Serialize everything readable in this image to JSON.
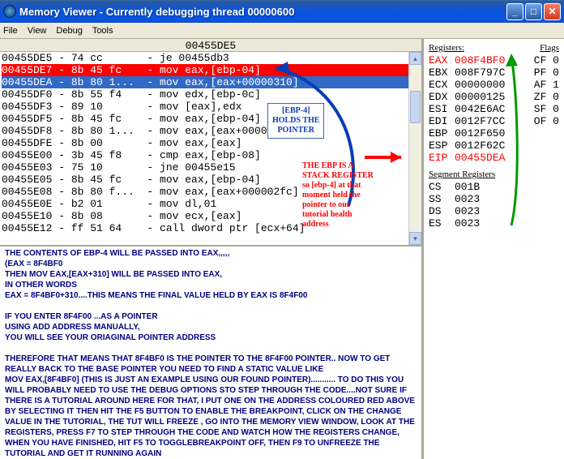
{
  "window": {
    "title": "Memory Viewer - Currently debugging thread 00000600"
  },
  "menu": {
    "file": "File",
    "view": "View",
    "debug": "Debug",
    "tools": "Tools"
  },
  "disasm": {
    "header": "00455DE5",
    "rows": [
      {
        "cls": "",
        "addr": "00455DE5",
        "bytes": "74 cc",
        "op": "je 00455db3"
      },
      {
        "cls": "red",
        "addr": "00455DE7",
        "bytes": "8b 45 fc",
        "op": "mov eax,[ebp-04]"
      },
      {
        "cls": "blue",
        "addr": "00455DEA",
        "bytes": "8b 80 1...",
        "op": "mov eax,[eax+00000310]"
      },
      {
        "cls": "",
        "addr": "00455DF0",
        "bytes": "8b 55 f4",
        "op": "mov edx,[ebp-0c]"
      },
      {
        "cls": "",
        "addr": "00455DF3",
        "bytes": "89 10",
        "op": "mov [eax],edx"
      },
      {
        "cls": "",
        "addr": "00455DF5",
        "bytes": "8b 45 fc",
        "op": "mov eax,[ebp-04]"
      },
      {
        "cls": "",
        "addr": "00455DF8",
        "bytes": "8b 80 1...",
        "op": "mov eax,[eax+00000310]"
      },
      {
        "cls": "",
        "addr": "00455DFE",
        "bytes": "8b 00",
        "op": "mov eax,[eax]"
      },
      {
        "cls": "",
        "addr": "00455E00",
        "bytes": "3b 45 f8",
        "op": "cmp eax,[ebp-08]"
      },
      {
        "cls": "",
        "addr": "00455E03",
        "bytes": "75 10",
        "op": "jne 00455e15"
      },
      {
        "cls": "",
        "addr": "00455E05",
        "bytes": "8b 45 fc",
        "op": "mov eax,[ebp-04]"
      },
      {
        "cls": "",
        "addr": "00455E08",
        "bytes": "8b 80 f...",
        "op": "mov eax,[eax+000002fc]"
      },
      {
        "cls": "",
        "addr": "00455E0E",
        "bytes": "b2 01",
        "op": "mov dl,01"
      },
      {
        "cls": "",
        "addr": "00455E10",
        "bytes": "8b 08",
        "op": "mov ecx,[eax]"
      },
      {
        "cls": "",
        "addr": "00455E12",
        "bytes": "ff 51 64",
        "op": "call dword ptr [ecx+64]"
      }
    ]
  },
  "registers": {
    "hdrReg": "Registers:",
    "hdrFlag": "Flags",
    "rows": [
      {
        "n": "EAX",
        "v": "008F4BF0",
        "f": "CF 0",
        "red": true
      },
      {
        "n": "EBX",
        "v": "008F797C",
        "f": "PF 0",
        "red": false
      },
      {
        "n": "ECX",
        "v": "00000000",
        "f": "AF 1",
        "red": false
      },
      {
        "n": "EDX",
        "v": "00000125",
        "f": "ZF 0",
        "red": false
      },
      {
        "n": "ESI",
        "v": "0042E6AC",
        "f": "SF 0",
        "red": false
      },
      {
        "n": "EDI",
        "v": "0012F7CC",
        "f": "OF 0",
        "red": false
      },
      {
        "n": "EBP",
        "v": "0012F650",
        "f": "",
        "red": false
      },
      {
        "n": "ESP",
        "v": "0012F62C",
        "f": "",
        "red": false
      },
      {
        "n": "EIP",
        "v": "00455DEA",
        "f": "",
        "red": true
      }
    ],
    "segHdr": "Segment Registers",
    "seg": [
      {
        "n": "CS",
        "v": "001B"
      },
      {
        "n": "SS",
        "v": "0023"
      },
      {
        "n": "DS",
        "v": "0023"
      },
      {
        "n": "ES",
        "v": "0023"
      }
    ]
  },
  "overlays": {
    "box1": "[EBP-4]\nHOLDS THE\nPOINTER",
    "ebpText": "THE EBP  IS A\nSTACK REGISTER\nso [ebp-4] at that\nmoment held the\npointer to our\ntutorial health\naddress"
  },
  "notes": {
    "l1": "THE CONTENTS OF EBP-4 WILL BE PASSED INTO EAX,,,,,",
    "l2": "(EAX = 8F4BF0",
    "l3": "THEN MOV EAX,[EAX+310] WILL BE PASSED INTO EAX,",
    "l4": "IN OTHER WORDS",
    "l5": "EAX = 8F4BF0+310....THIS MEANS THE FINAL VALUE HELD BY EAX IS 8F4F00",
    "l6": "IF YOU ENTER 8F4F00 ...AS A POINTER",
    "l7": "USING ADD ADDRESS MANUALLY,",
    "l8": "YOU WILL SEE YOUR  ORIAGINAL POINTER ADDRESS",
    "l9": "THEREFORE THAT MEANS THAT 8F4BF0 IS THE POINTER TO THE 8F4F00 POINTER.. NOW TO GET REALLY BACK TO THE BASE POINTER YOU NEED TO FIND A STATIC VALUE LIKE",
    "l10": "MOV EAX,[8F4BF0]    (THIS IS JUST AN EXAMPLE USING OUR FOUND POINTER)........... TO DO THIS YOU WILL PROBABLY NEED TO USE THE DEBUG OPTIONS STO STEP THROUGH THE CODE....NOT SURE IF THERE IS A TUTORIAL AROUND HERE FOR THAT,   I PUT ONE ON THE ADDRESS COLOURED RED ABOVE BY SELECTING IT THEN HIT THE F5 BUTTON TO ENABLE THE BREAKPOINT, CLICK ON THE  CHANGE VALUE IN THE TUTORIAL, THE TUT WILL FREEZE , GO INTO THE MEMORY VIEW WINDOW, LOOK AT THE REGISTERS, PRESS F7 TO STEP THROUGH THE CODE AND WATCH HOW THE REGISTERS CHANGE, WHEN YOU HAVE FINISHED, HIT F5 TO TOGGLEBREAKPOINT OFF, THEN F9 TO UNFREEZE THE TUTORIAL AND GET IT RUNNING AGAIN"
  }
}
